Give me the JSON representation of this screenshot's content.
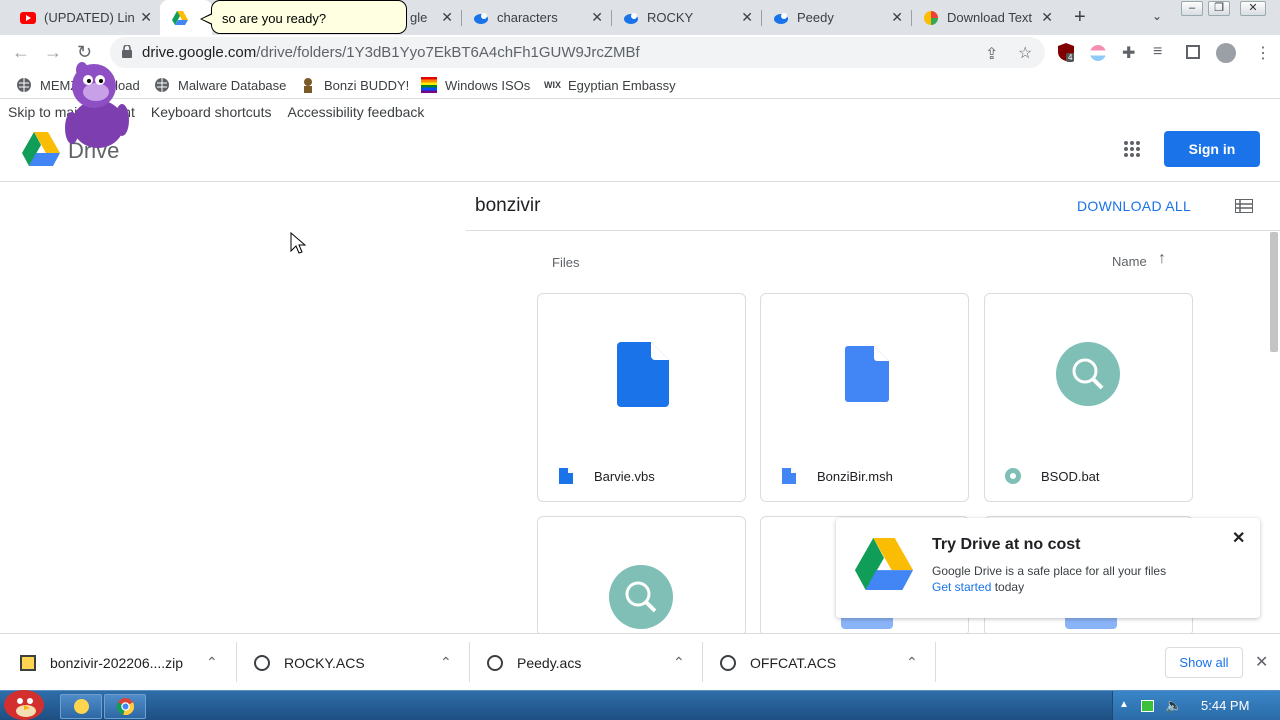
{
  "tabs": [
    {
      "label": "(UPDATED) Lin",
      "icon": "youtube-icon"
    },
    {
      "label": "",
      "icon": "google-drive-icon"
    },
    {
      "label": "gle",
      "icon": "google-drive-icon"
    },
    {
      "label": "characters",
      "icon": "peedy-icon"
    },
    {
      "label": "ROCKY",
      "icon": "peedy-icon"
    },
    {
      "label": "Peedy",
      "icon": "peedy-icon"
    },
    {
      "label": "Download Text",
      "icon": "colorful-icon"
    }
  ],
  "speech_bubble": "so are you ready?",
  "toolbar": {
    "url_host": "drive.google.com",
    "url_path": "/drive/folders/1Y3dB1Yyo7EkBT6A4chFh1GUW9JrcZMBf",
    "extension_badge": "4"
  },
  "bookmarks": [
    {
      "label": "MEMZ Download",
      "icon": "globe-icon"
    },
    {
      "label": "Malware Database",
      "icon": "globe-icon"
    },
    {
      "label": "Bonzi BUDDY!",
      "icon": "bonzi-icon"
    },
    {
      "label": "Windows ISOs",
      "icon": "rainbow-flag-icon"
    },
    {
      "label": "Egyptian Embassy",
      "icon": "wix-icon"
    }
  ],
  "skip_links": [
    "Skip to main content",
    "Keyboard shortcuts",
    "Accessibility feedback"
  ],
  "drive": {
    "product": "Drive",
    "sign_in": "Sign in",
    "folder_name": "bonzivir",
    "download_all": "DOWNLOAD ALL",
    "files_heading": "Files",
    "sort_label": "Name",
    "files": [
      {
        "name": "Barvie.vbs",
        "type": "doc"
      },
      {
        "name": "BonziBir.msh",
        "type": "doc"
      },
      {
        "name": "BSOD.bat",
        "type": "search"
      },
      {
        "name": "",
        "type": "search"
      },
      {
        "name": "",
        "type": "folder"
      },
      {
        "name": "",
        "type": "folder"
      }
    ]
  },
  "promo": {
    "title": "Try Drive at no cost",
    "line1": "Google Drive is a safe place for all your files",
    "link": "Get started",
    "line2_suffix": " today"
  },
  "downloads": [
    {
      "name": "bonzivir-202206....zip"
    },
    {
      "name": "ROCKY.ACS"
    },
    {
      "name": "Peedy.acs"
    },
    {
      "name": "OFFCAT.ACS"
    }
  ],
  "downloads_show_all": "Show all",
  "taskbar": {
    "clock": "5:44 PM"
  },
  "colors": {
    "accent": "#1a73e8",
    "tabbar": "#dee1e6",
    "taskbar": "#2f6eaa"
  }
}
